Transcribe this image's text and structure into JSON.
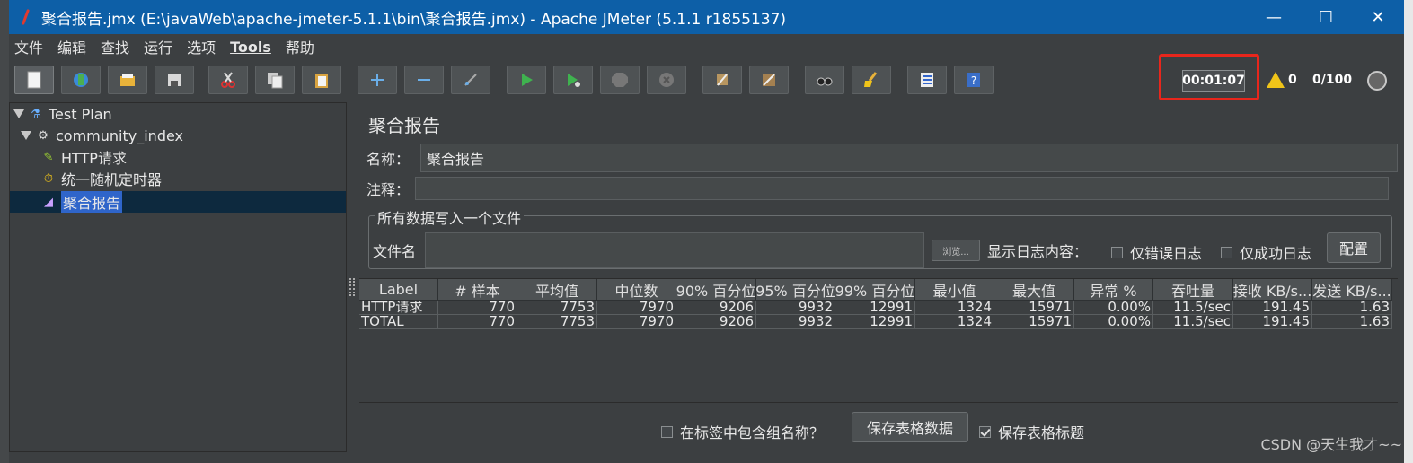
{
  "window": {
    "title": "聚合报告.jmx (E:\\javaWeb\\apache-jmeter-5.1.1\\bin\\聚合报告.jmx) - Apache JMeter (5.1.1 r1855137)",
    "minimize": "—",
    "maximize": "☐",
    "close": "✕"
  },
  "menu": [
    "文件",
    "编辑",
    "查找",
    "运行",
    "选项",
    "Tools",
    "帮助"
  ],
  "toolbar": {
    "timer": "00:01:07",
    "warning_count": "0",
    "threads": "0/100"
  },
  "tree": {
    "items": [
      {
        "label": "Test Plan",
        "icon": "test-plan-icon"
      },
      {
        "label": "community_index",
        "icon": "gear-icon"
      },
      {
        "label": "HTTP请求",
        "icon": "pencil-icon"
      },
      {
        "label": "统一随机定时器",
        "icon": "timer-icon"
      },
      {
        "label": "聚合报告",
        "icon": "chart-icon"
      }
    ]
  },
  "panel": {
    "title": "聚合报告",
    "name_label": "名称：",
    "name_value": "聚合报告",
    "comment_label": "注释：",
    "comment_value": "",
    "fileset_legend": "所有数据写入一个文件",
    "filename_label": "文件名",
    "browse_label": "浏览...",
    "log_label": "显示日志内容：",
    "errors_only": "仅错误日志",
    "success_only": "仅成功日志",
    "config_label": "配置"
  },
  "table": {
    "headers": [
      "Label",
      "# 样本",
      "平均值",
      "中位数",
      "90% 百分位",
      "95% 百分位",
      "99% 百分位",
      "最小值",
      "最大值",
      "异常 %",
      "吞吐量",
      "接收 KB/s...",
      "发送 KB/s..."
    ],
    "rows": [
      [
        "HTTP请求",
        "770",
        "7753",
        "7970",
        "9206",
        "9932",
        "12991",
        "1324",
        "15971",
        "0.00%",
        "11.5/sec",
        "191.45",
        "1.63"
      ],
      [
        "TOTAL",
        "770",
        "7753",
        "7970",
        "9206",
        "9932",
        "12991",
        "1324",
        "15971",
        "0.00%",
        "11.5/sec",
        "191.45",
        "1.63"
      ]
    ]
  },
  "bottom": {
    "include_group": "在标签中包含组名称？",
    "save_table": "保存表格数据",
    "save_header": "保存表格标题"
  },
  "watermark": "CSDN @天生我才~~"
}
